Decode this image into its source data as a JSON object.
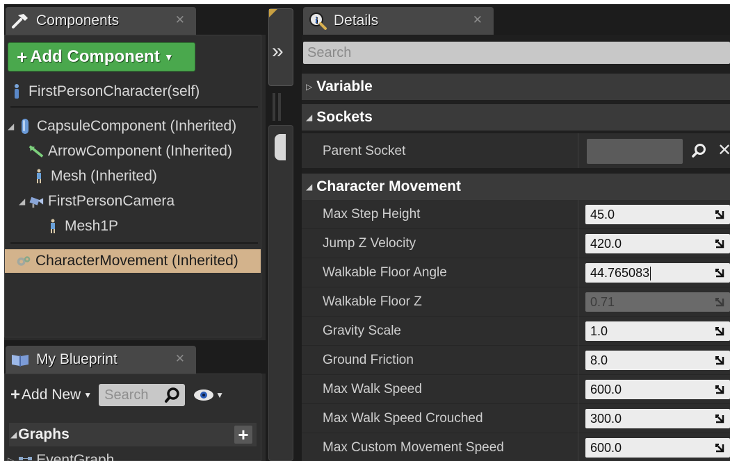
{
  "components_panel": {
    "tab_label": "Components",
    "add_component_label": "Add Component",
    "items": [
      {
        "label": "FirstPersonCharacter(self)"
      },
      {
        "label": "CapsuleComponent (Inherited)"
      },
      {
        "label": "ArrowComponent (Inherited)"
      },
      {
        "label": "Mesh (Inherited)"
      },
      {
        "label": "FirstPersonCamera"
      },
      {
        "label": "Mesh1P"
      },
      {
        "label": "CharacterMovement (Inherited)"
      }
    ]
  },
  "blueprint_panel": {
    "tab_label": "My Blueprint",
    "add_new_label": "Add New",
    "search_placeholder": "Search",
    "graphs_label": "Graphs",
    "event_graph_label": "EventGraph"
  },
  "details_panel": {
    "tab_label": "Details",
    "search_placeholder": "Search",
    "categories": {
      "variable": "Variable",
      "sockets": "Sockets",
      "character_movement": "Character Movement"
    },
    "parent_socket_label": "Parent Socket",
    "properties": [
      {
        "name": "Max Step Height",
        "value": "45.0"
      },
      {
        "name": "Jump Z Velocity",
        "value": "420.0"
      },
      {
        "name": "Walkable Floor Angle",
        "value": "44.765083"
      },
      {
        "name": "Walkable Floor Z",
        "value": "0.71"
      },
      {
        "name": "Gravity Scale",
        "value": "1.0"
      },
      {
        "name": "Ground Friction",
        "value": "8.0"
      },
      {
        "name": "Max Walk Speed",
        "value": "600.0"
      },
      {
        "name": "Max Walk Speed Crouched",
        "value": "300.0"
      },
      {
        "name": "Max Custom Movement Speed",
        "value": "600.0"
      }
    ]
  },
  "colors": {
    "add_component_green": "#4aa84d",
    "selection": "#d3b38c",
    "panel_bg": "#2d2d2d",
    "category_bg": "#3a3a3a"
  }
}
